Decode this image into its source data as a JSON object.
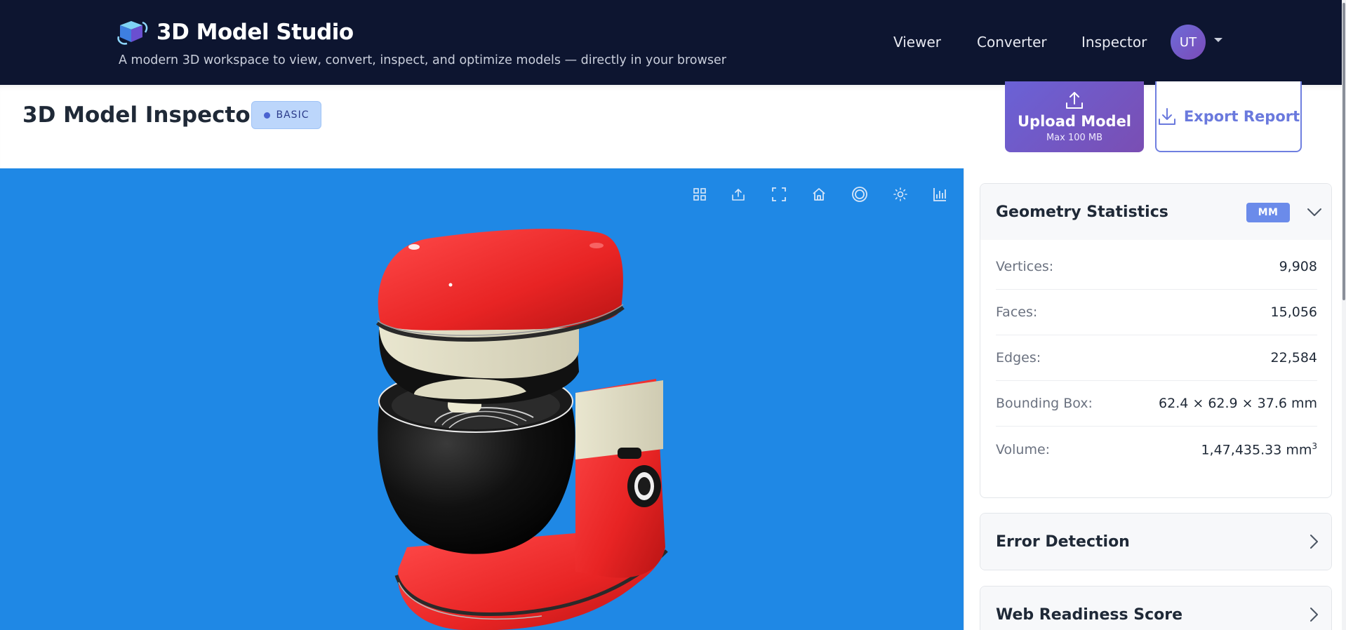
{
  "header": {
    "brand_name": "3D Model Studio",
    "tagline": "A modern 3D workspace to view, convert, inspect, and optimize models — directly in your browser",
    "nav": [
      "Viewer",
      "Converter",
      "Inspector"
    ],
    "avatar_initials": "UT"
  },
  "page": {
    "title": "3D Model Inspector",
    "badge": "BASIC",
    "upload_label": "Upload Model",
    "upload_sub": "Max 100 MB",
    "export_label": "Export Report"
  },
  "viewer": {
    "background_color": "#1f88e5",
    "toolbar_icons": [
      "grid-icon",
      "upload-view-icon",
      "fullscreen-icon",
      "home-icon",
      "target-icon",
      "lighting-icon",
      "chart-icon"
    ]
  },
  "geometry": {
    "title": "Geometry Statistics",
    "unit": "MM",
    "stats": [
      {
        "label": "Vertices:",
        "value": "9,908"
      },
      {
        "label": "Faces:",
        "value": "15,056"
      },
      {
        "label": "Edges:",
        "value": "22,584"
      },
      {
        "label": "Bounding Box:",
        "value": "62.4 × 62.9 × 37.6 mm"
      },
      {
        "label": "Volume:",
        "value": "1,47,435.33 mm",
        "sup": "3"
      }
    ]
  },
  "panels": {
    "error_detection": "Error Detection",
    "web_readiness": "Web Readiness Score"
  },
  "colors": {
    "header_bg": "#0d1530",
    "accent": "#6a62d6",
    "viewer_bg": "#1f88e5"
  }
}
